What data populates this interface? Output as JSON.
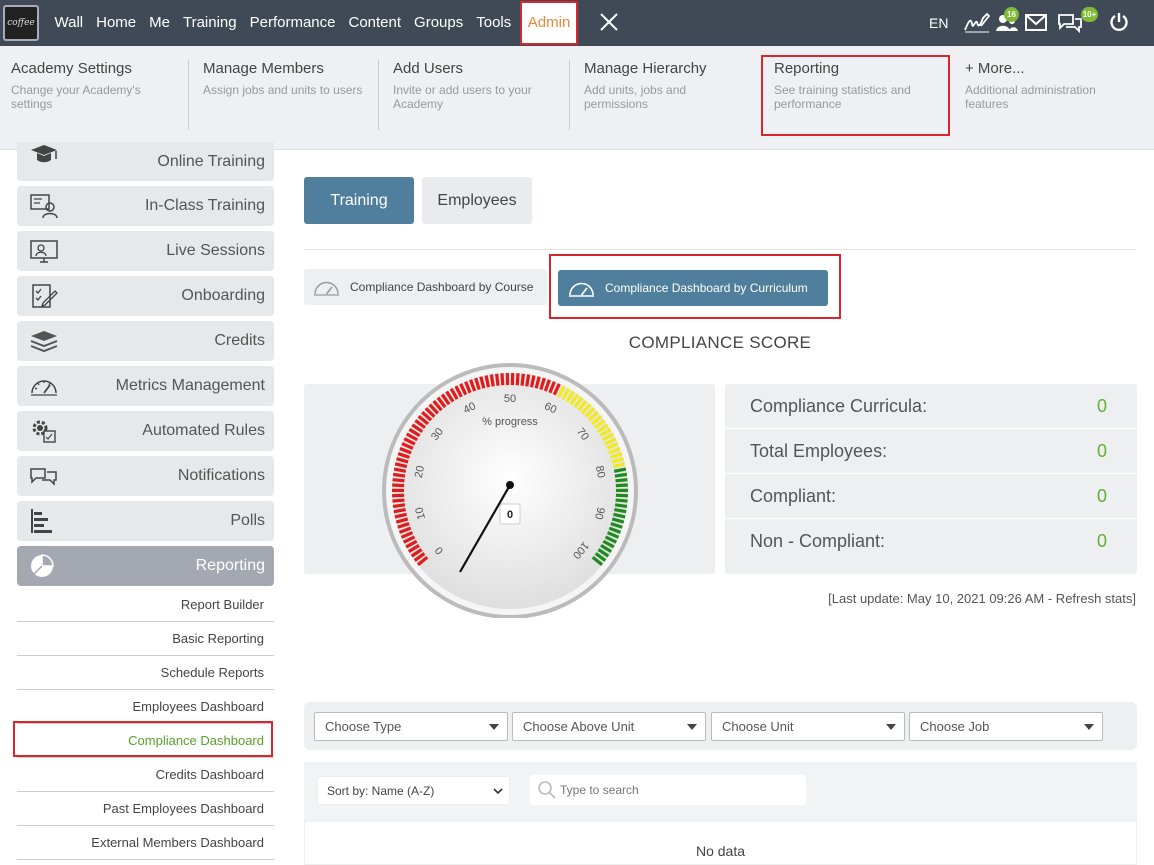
{
  "topbar": {
    "logo_text": "coffee",
    "nav": [
      "Wall",
      "Home",
      "Me",
      "Training",
      "Performance",
      "Content",
      "Groups",
      "Tools",
      "Admin"
    ],
    "lang": "EN",
    "badge_people": "16",
    "badge_chat": "10+"
  },
  "mega": [
    {
      "title": "Academy Settings",
      "desc": "Change your Academy's settings"
    },
    {
      "title": "Manage Members",
      "desc": "Assign jobs and units to users"
    },
    {
      "title": "Add Users",
      "desc": "Invite or add users to your Academy"
    },
    {
      "title": "Manage Hierarchy",
      "desc": "Add units, jobs and permissions"
    },
    {
      "title": "Reporting",
      "desc": "See training statistics and performance"
    },
    {
      "title": "+ More...",
      "desc": "Additional administration features"
    }
  ],
  "sidebar": {
    "items": [
      "Online Training",
      "In-Class Training",
      "Live Sessions",
      "Onboarding",
      "Credits",
      "Metrics Management",
      "Automated Rules",
      "Notifications",
      "Polls",
      "Reporting"
    ],
    "sub": [
      "Report Builder",
      "Basic Reporting",
      "Schedule Reports",
      "Employees Dashboard",
      "Compliance Dashboard",
      "Credits Dashboard",
      "Past Employees Dashboard",
      "External Members Dashboard"
    ]
  },
  "tabs": {
    "training": "Training",
    "employees": "Employees"
  },
  "dash_tabs": {
    "course": "Compliance Dashboard by Course",
    "curriculum": "Compliance Dashboard by Curriculum"
  },
  "score_title": "COMPLIANCE SCORE",
  "gauge": {
    "label": "% progress",
    "value": "0",
    "ticks": [
      "0",
      "10",
      "20",
      "30",
      "40",
      "50",
      "60",
      "70",
      "80",
      "90",
      "100"
    ]
  },
  "stats": [
    {
      "label": "Compliance Curricula:",
      "value": "0"
    },
    {
      "label": "Total Employees:",
      "value": "0"
    },
    {
      "label": "Compliant:",
      "value": "0"
    },
    {
      "label": "Non - Compliant:",
      "value": "0"
    }
  ],
  "last_update": "[Last update: May 10, 2021 09:26 AM - Refresh stats]",
  "filters": [
    "Choose Type",
    "Choose Above Unit",
    "Choose Unit",
    "Choose Job"
  ],
  "sort": "Sort by: Name (A-Z)",
  "search_placeholder": "Type to search",
  "no_data": "No data",
  "colors": {
    "topbar": "#3f4a56",
    "accent": "#4f7f9c",
    "admin": "#e8893a",
    "green": "#62b030",
    "red_highlight": "#d9262e"
  }
}
